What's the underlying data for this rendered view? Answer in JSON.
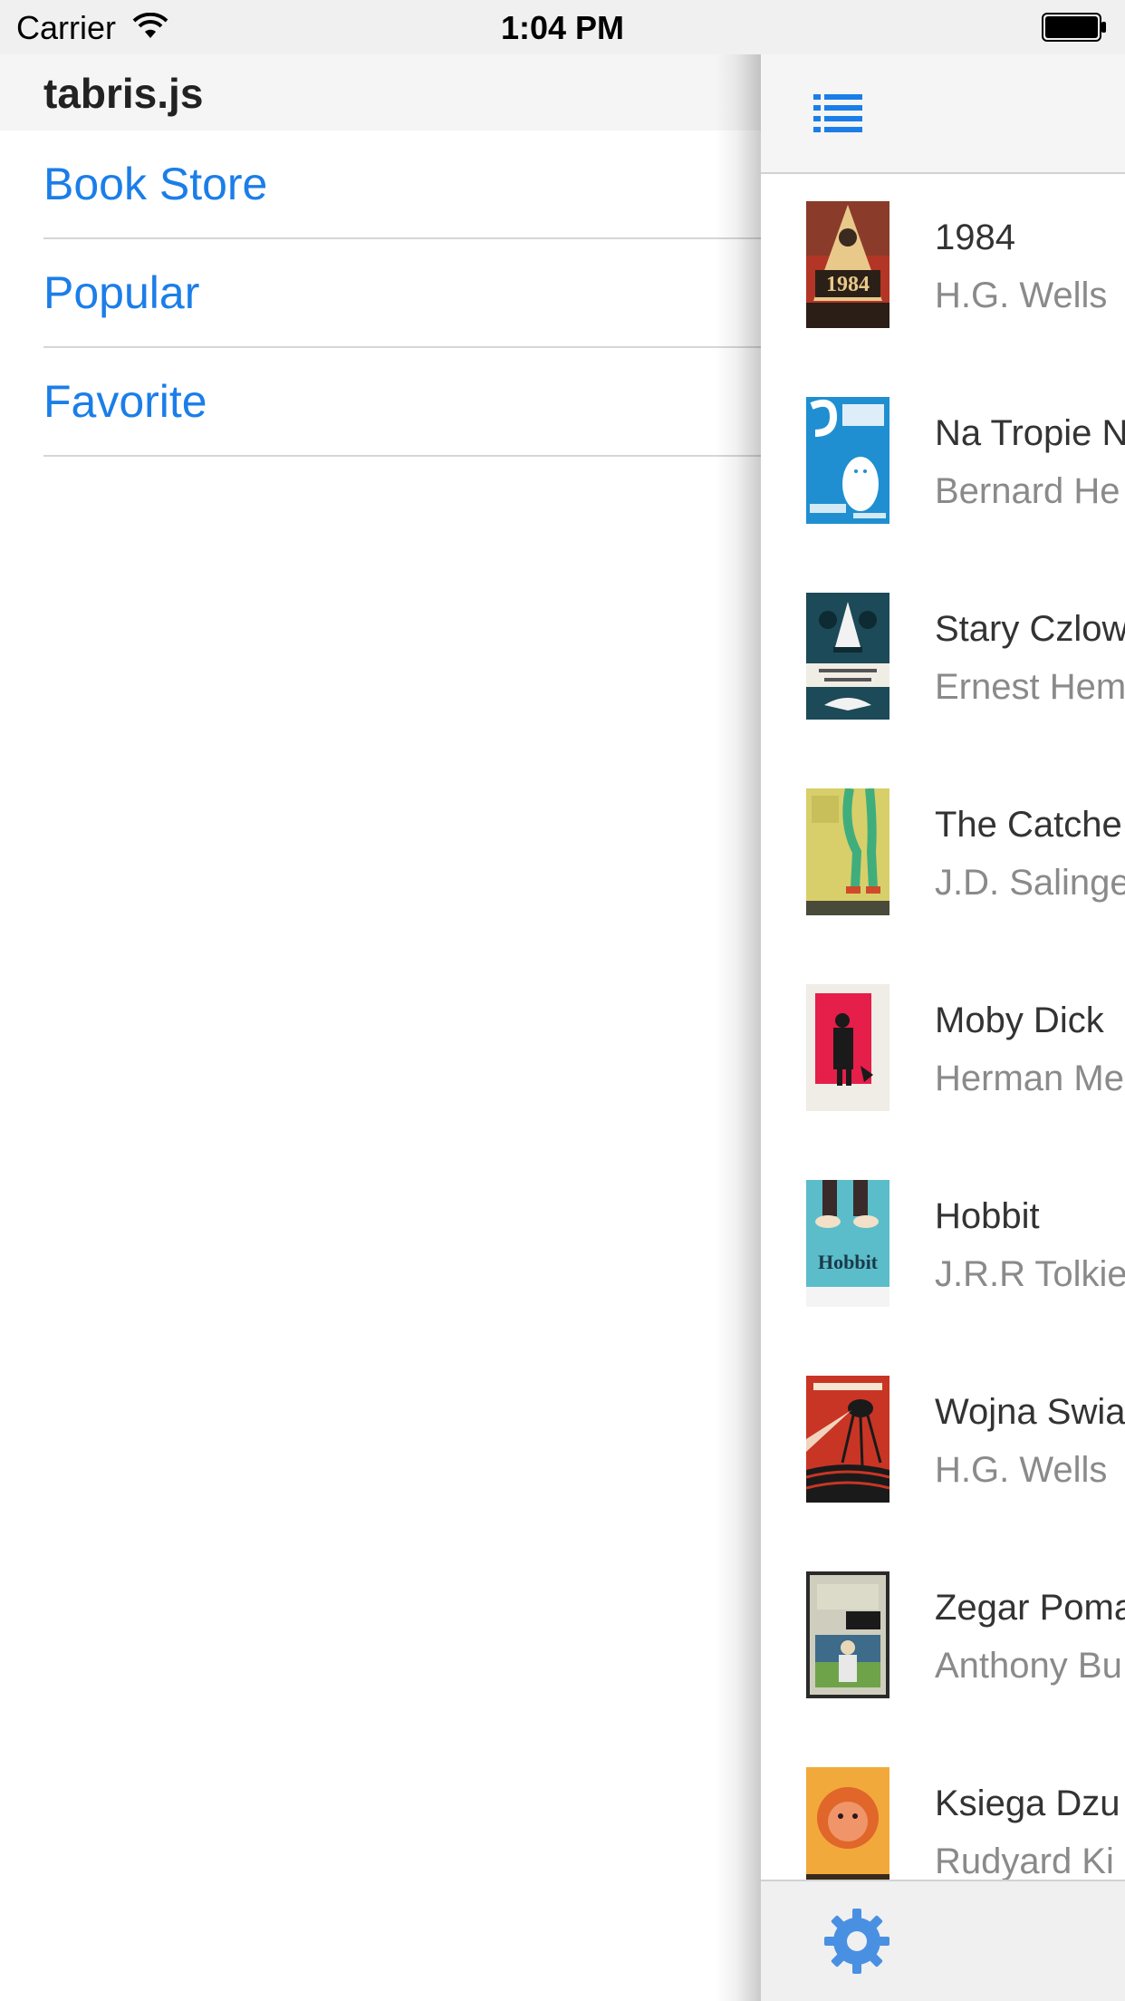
{
  "status_bar": {
    "carrier": "Carrier",
    "time": "1:04 PM",
    "wifi_icon": "wifi-icon",
    "battery_icon": "battery-icon"
  },
  "drawer": {
    "title": "tabris.js",
    "items": [
      {
        "label": "Book Store"
      },
      {
        "label": "Popular"
      },
      {
        "label": "Favorite"
      }
    ]
  },
  "toolbar": {
    "menu_icon": "list-menu-icon"
  },
  "books": [
    {
      "title": "1984",
      "author": "H.G. Wells",
      "cover_icon": "book-cover-1984"
    },
    {
      "title": "Na Tropie N",
      "author": "Bernard He",
      "cover_icon": "book-cover-na-tropie"
    },
    {
      "title": "Stary Czlow",
      "author": "Ernest Hem",
      "cover_icon": "book-cover-stary-czlowiek"
    },
    {
      "title": "The Catche",
      "author": "J.D. Salinge",
      "cover_icon": "book-cover-catcher"
    },
    {
      "title": "Moby Dick",
      "author": "Herman Me",
      "cover_icon": "book-cover-moby-dick"
    },
    {
      "title": "Hobbit",
      "author": "J.R.R Tolkie",
      "cover_icon": "book-cover-hobbit"
    },
    {
      "title": "Wojna Swia",
      "author": "H.G. Wells",
      "cover_icon": "book-cover-wojna-swiatow"
    },
    {
      "title": "Zegar Poma",
      "author": "Anthony Bu",
      "cover_icon": "book-cover-zegar"
    },
    {
      "title": "Ksiega Dzu",
      "author": "Rudyard Ki",
      "cover_icon": "book-cover-ksiega"
    }
  ],
  "bottom_bar": {
    "settings_icon": "gear-icon"
  },
  "colors": {
    "accent": "#1b7ee8",
    "settings_icon": "#4a90e2"
  }
}
